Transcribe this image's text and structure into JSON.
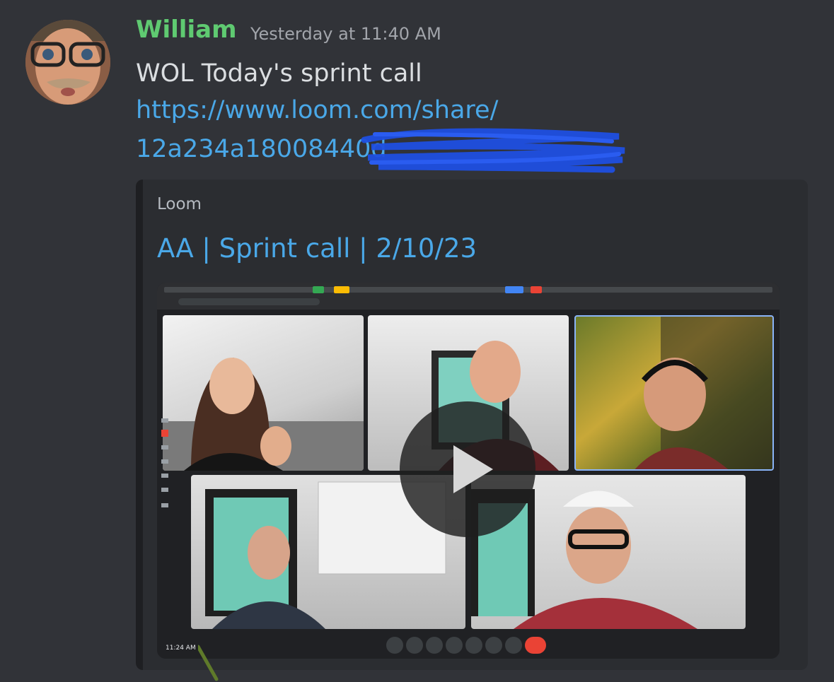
{
  "message": {
    "author": "William",
    "author_color": "#5fca71",
    "timestamp": "Yesterday at 11:40 AM",
    "text": "WOL Today's sprint call",
    "link_line1": "https://www.loom.com/share/",
    "link_line2": "12a234a18008440d"
  },
  "embed": {
    "provider": "Loom",
    "title": "AA | Sprint call | 2/10/23",
    "video": {
      "meeting_time": "11:24 AM",
      "participants": 5,
      "play_icon": "play-icon"
    }
  },
  "colors": {
    "background": "#313338",
    "embed_background": "#2b2d31",
    "link": "#4aa8e8",
    "timestamp": "#a2a5ab",
    "text": "#dbdee1"
  }
}
